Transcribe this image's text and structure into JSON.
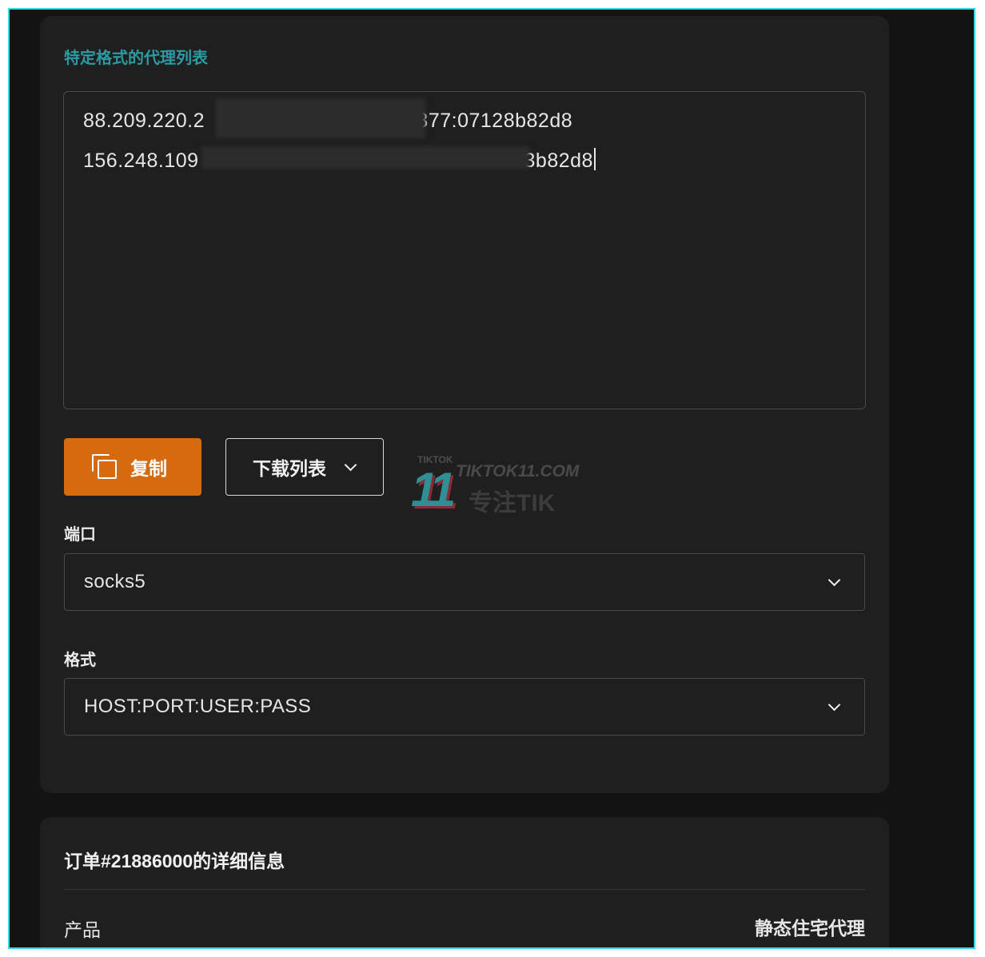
{
  "proxy_panel": {
    "section_label": "特定格式的代理列表",
    "proxy_list": {
      "line1_start": "88.209.220.2",
      "line1_end": ":377:07128b82d8",
      "line2_start": "156.248.109",
      "line2_end": "3b82d8"
    },
    "copy_button_label": "复制",
    "download_button_label": "下载列表",
    "port": {
      "label": "端口",
      "value": "socks5"
    },
    "format": {
      "label": "格式",
      "value": "HOST:PORT:USER:PASS"
    }
  },
  "watermark": {
    "brand_small": "TIKTOK",
    "number": "11",
    "site": "TIKTOK11.COM",
    "slogan": "专注TIK"
  },
  "order_panel": {
    "title": "订单#21886000的详细信息",
    "rows": [
      {
        "label": "产品",
        "value": "静态住宅代理"
      }
    ]
  },
  "colors": {
    "accent_orange": "#d66a0f",
    "teal_label": "#2b9aa3",
    "background": "#131313",
    "card": "#1f1f1f"
  }
}
